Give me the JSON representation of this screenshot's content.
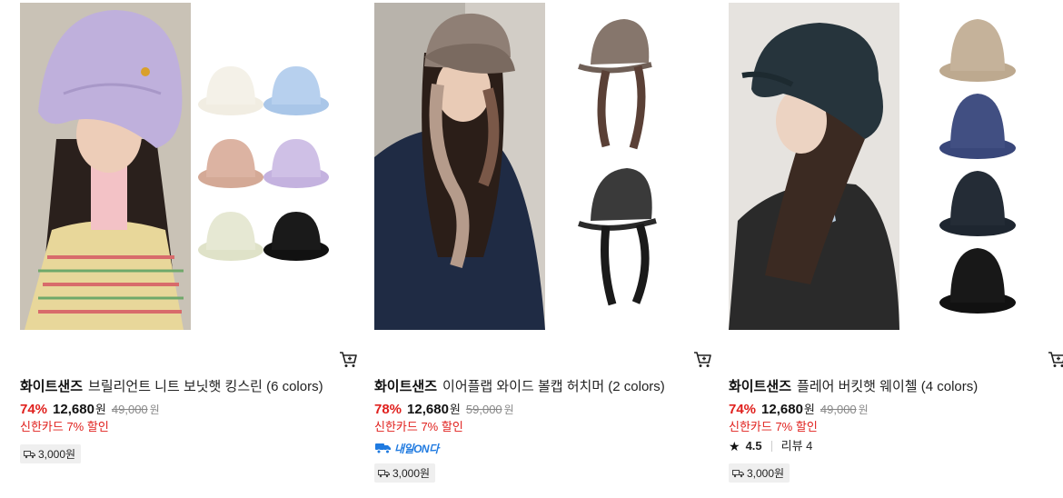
{
  "products": [
    {
      "brand": "화이트샌즈",
      "name": "브릴리언트 니트 보닛햇 킹스린 (6 colors)",
      "discount": "74%",
      "price": "12,680",
      "currency": "원",
      "original_price": "49,000",
      "original_currency": "원",
      "card_promo": "신한카드 7% 할인",
      "shipping": "3,000원",
      "image_icon": "product-photo-knit-bucket-hat"
    },
    {
      "brand": "화이트샌즈",
      "name": "이어플랩 와이드 볼캡 허치머 (2 colors)",
      "discount": "78%",
      "price": "12,680",
      "currency": "원",
      "original_price": "59,000",
      "original_currency": "원",
      "card_promo": "신한카드 7% 할인",
      "delivery_badge": "내일ON다",
      "shipping": "3,000원",
      "image_icon": "product-photo-earflap-cap"
    },
    {
      "brand": "화이트샌즈",
      "name": "플레어 버킷햇 웨이첼 (4 colors)",
      "discount": "74%",
      "price": "12,680",
      "currency": "원",
      "original_price": "49,000",
      "original_currency": "원",
      "card_promo": "신한카드 7% 할인",
      "rating": "4.5",
      "review_label": "리뷰 4",
      "shipping": "3,000원",
      "image_icon": "product-photo-flare-bucket-hat"
    }
  ],
  "colors": {
    "discount_red": "#e0201d",
    "delivery_blue": "#1f7ae0",
    "ship_bg": "#efefef"
  }
}
